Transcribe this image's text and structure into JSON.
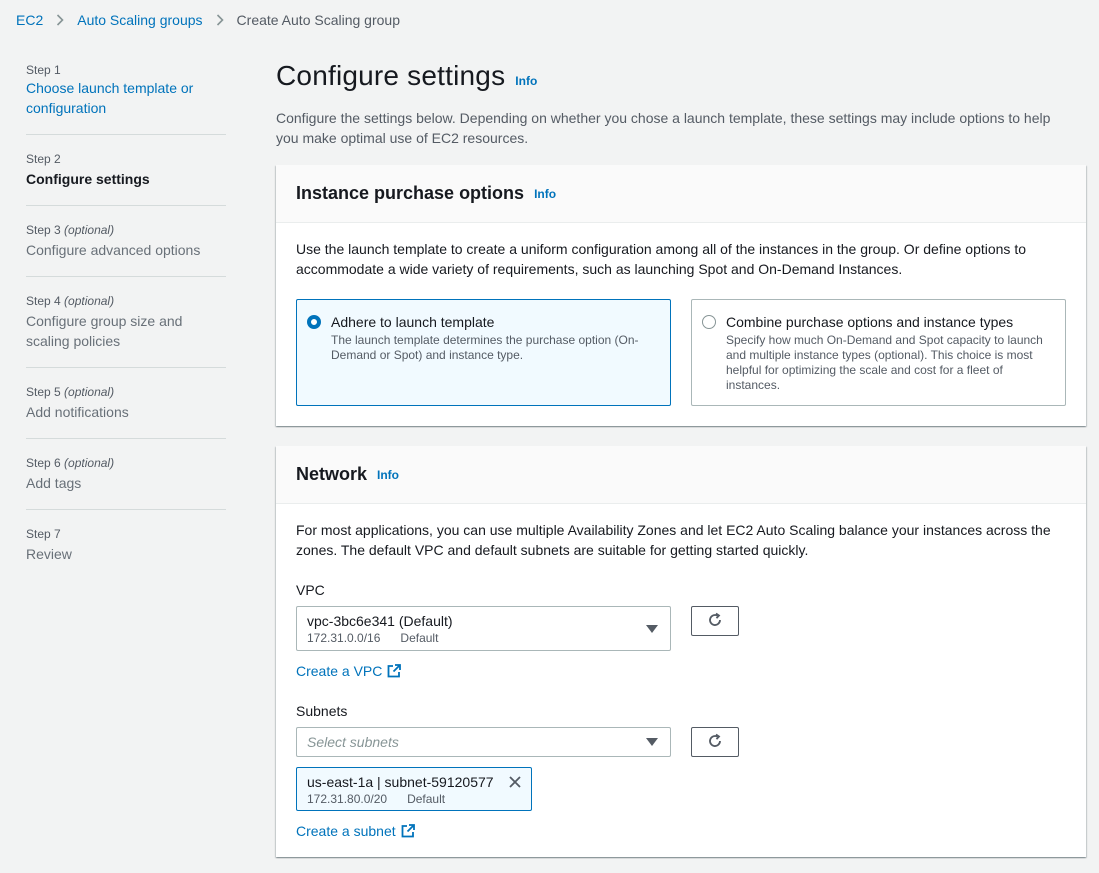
{
  "breadcrumb": {
    "items": [
      "EC2",
      "Auto Scaling groups"
    ],
    "current": "Create Auto Scaling group"
  },
  "steps": [
    {
      "num": "Step 1",
      "optional": "",
      "title": "Choose launch template or configuration",
      "state": "link"
    },
    {
      "num": "Step 2",
      "optional": "",
      "title": "Configure settings",
      "state": "current"
    },
    {
      "num": "Step 3",
      "optional": "(optional)",
      "title": "Configure advanced options",
      "state": "disabled"
    },
    {
      "num": "Step 4",
      "optional": "(optional)",
      "title": "Configure group size and scaling policies",
      "state": "disabled"
    },
    {
      "num": "Step 5",
      "optional": "(optional)",
      "title": "Add notifications",
      "state": "disabled"
    },
    {
      "num": "Step 6",
      "optional": "(optional)",
      "title": "Add tags",
      "state": "disabled"
    },
    {
      "num": "Step 7",
      "optional": "",
      "title": "Review",
      "state": "disabled"
    }
  ],
  "page": {
    "title": "Configure settings",
    "info": "Info",
    "description": "Configure the settings below. Depending on whether you chose a launch template, these settings may include options to help you make optimal use of EC2 resources."
  },
  "purchase": {
    "title": "Instance purchase options",
    "info": "Info",
    "description": "Use the launch template to create a uniform configuration among all of the instances in the group. Or define options to accommodate a wide variety of requirements, such as launching Spot and On-Demand Instances.",
    "options": [
      {
        "title": "Adhere to launch template",
        "desc": "The launch template determines the purchase option (On-Demand or Spot) and instance type.",
        "selected": true
      },
      {
        "title": "Combine purchase options and instance types",
        "desc": "Specify how much On-Demand and Spot capacity to launch and multiple instance types (optional). This choice is most helpful for optimizing the scale and cost for a fleet of instances.",
        "selected": false
      }
    ]
  },
  "network": {
    "title": "Network",
    "info": "Info",
    "description": "For most applications, you can use multiple Availability Zones and let EC2 Auto Scaling balance your instances across the zones. The default VPC and default subnets are suitable for getting started quickly.",
    "vpc_label": "VPC",
    "vpc_value": "vpc-3bc6e341 (Default)",
    "vpc_cidr": "172.31.0.0/16",
    "vpc_tag": "Default",
    "create_vpc": "Create a VPC",
    "subnets_label": "Subnets",
    "subnets_placeholder": "Select subnets",
    "subnet_token": {
      "label": "us-east-1a | subnet-59120577",
      "cidr": "172.31.80.0/20",
      "tag": "Default"
    },
    "create_subnet": "Create a subnet"
  },
  "colors": {
    "link": "#0073bb",
    "selected_bg": "#f1faff",
    "background": "#f2f3f3"
  },
  "icons": [
    "chevron-right-icon",
    "refresh-icon",
    "external-link-icon",
    "close-icon",
    "caret-down-icon"
  ]
}
